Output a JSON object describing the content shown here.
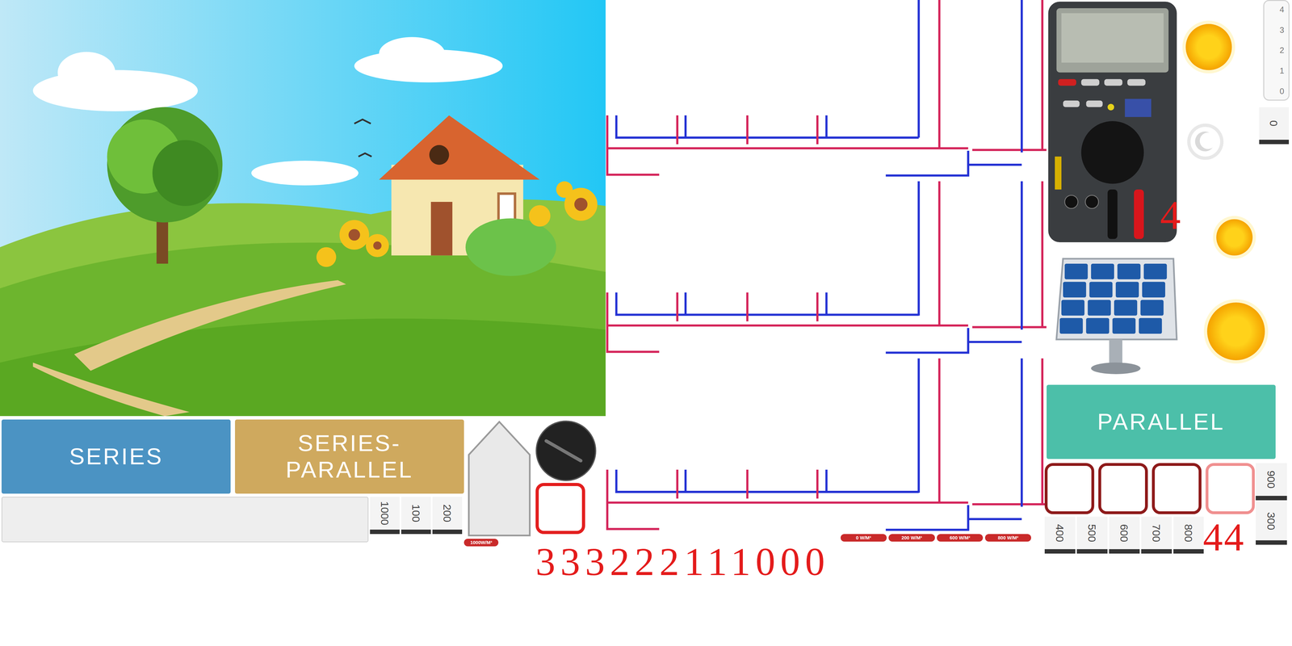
{
  "scene": {
    "kind": "landscape"
  },
  "mode_buttons": [
    {
      "label": "SERIES",
      "color": "#4b93c3"
    },
    {
      "label": "SERIES-PARALLEL",
      "color": "#cfa95e"
    }
  ],
  "parallel_button": {
    "label": "PARALLEL",
    "color": "#4cbfa9"
  },
  "resistor_cards": [
    "1000",
    "100",
    "200"
  ],
  "panel_house": {
    "badge": "1000W/M²"
  },
  "counter_left": "333222111000",
  "irradiance_pills": [
    "0 W/M²",
    "200 W/M²",
    "600 W/M²",
    "800 W/M²"
  ],
  "meter": {
    "probe_count": "4"
  },
  "squares": [
    {
      "selected": false
    },
    {
      "selected": false
    },
    {
      "selected": false
    },
    {
      "selected": true
    }
  ],
  "square_counter": "44",
  "bottom_cards": [
    "400",
    "500",
    "600",
    "700",
    "800"
  ],
  "side_cards": [
    "900",
    "300"
  ],
  "level_scale": {
    "ticks": [
      "4",
      "3",
      "2",
      "1",
      "0"
    ],
    "value": "0"
  },
  "sky": [
    {
      "kind": "sun"
    },
    {
      "kind": "moon"
    },
    {
      "kind": "sun"
    },
    {
      "kind": "sun"
    }
  ]
}
